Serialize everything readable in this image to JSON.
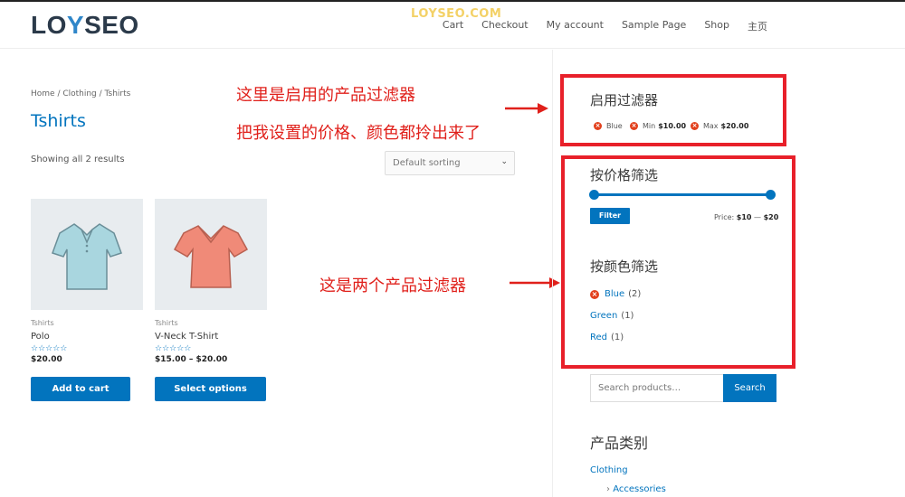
{
  "header": {
    "logo_prefix": "LO",
    "logo_y": "Y",
    "logo_suffix": "SEO",
    "watermark": "LOYSEO.COM",
    "nav": [
      "Cart",
      "Checkout",
      "My account",
      "Sample Page",
      "Shop",
      "主页"
    ]
  },
  "breadcrumb": "Home / Clothing / Tshirts",
  "page_title": "Tshirts",
  "result_count": "Showing all 2 results",
  "sort": {
    "selected": "Default sorting"
  },
  "annotations": {
    "top_line1": "这里是启用的产品过滤器",
    "top_line2": "把我设置的价格、颜色都拎出来了",
    "middle": "这是两个产品过滤器"
  },
  "products": [
    {
      "category": "Tshirts",
      "name": "Polo",
      "stars": "☆☆☆☆☆",
      "price": "$20.00",
      "button": "Add to cart",
      "color": "#a9d6df"
    },
    {
      "category": "Tshirts",
      "name": "V-Neck T-Shirt",
      "stars": "☆☆☆☆☆",
      "price": "$15.00 – $20.00",
      "button": "Select options",
      "color": "#f08a78"
    }
  ],
  "active_filters": {
    "title": "启用过滤器",
    "chips": [
      {
        "label": "Blue",
        "prefix": "",
        "value": ""
      },
      {
        "label": "Min",
        "prefix": "Min",
        "value": "$10.00"
      },
      {
        "label": "Max",
        "prefix": "Max",
        "value": "$20.00"
      }
    ]
  },
  "price_filter": {
    "title": "按价格筛选",
    "button": "Filter",
    "label": "Price:",
    "min": "$10",
    "sep": "—",
    "max": "$20"
  },
  "color_filter": {
    "title": "按颜色筛选",
    "items": [
      {
        "name": "Blue",
        "count": "(2)",
        "active": true
      },
      {
        "name": "Green",
        "count": "(1)",
        "active": false
      },
      {
        "name": "Red",
        "count": "(1)",
        "active": false
      }
    ]
  },
  "search": {
    "placeholder": "Search products…",
    "button": "Search"
  },
  "categories": {
    "title": "产品类别",
    "items": [
      "Clothing",
      "Accessories"
    ]
  },
  "colors": {
    "accent": "#0274be",
    "annotation": "#e0201b",
    "remove": "#e2401c"
  }
}
